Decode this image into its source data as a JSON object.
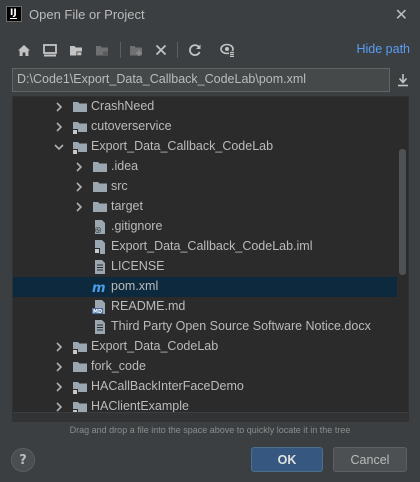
{
  "window": {
    "title": "Open File or Project"
  },
  "toolbar": {
    "buttons": [
      "home-icon",
      "desktop-icon",
      "project-folder-icon",
      "module-folder-icon",
      "new-folder-icon",
      "delete-icon",
      "refresh-icon",
      "show-hidden-icon"
    ],
    "hide_path_label": "Hide path"
  },
  "path": {
    "value": "D:\\Code1\\Export_Data_Callback_CodeLab\\pom.xml"
  },
  "tree": {
    "rows": [
      {
        "label": "CrashNeed",
        "type": "folder",
        "expanded": false,
        "depth": 1,
        "selected": false
      },
      {
        "label": "cutoverservice",
        "type": "module",
        "expanded": false,
        "depth": 1,
        "selected": false
      },
      {
        "label": "Export_Data_Callback_CodeLab",
        "type": "module",
        "expanded": true,
        "depth": 1,
        "selected": false
      },
      {
        "label": ".idea",
        "type": "folder",
        "expanded": false,
        "depth": 2,
        "selected": false
      },
      {
        "label": "src",
        "type": "folder",
        "expanded": false,
        "depth": 2,
        "selected": false
      },
      {
        "label": "target",
        "type": "folder-orange",
        "expanded": false,
        "depth": 2,
        "selected": false
      },
      {
        "label": ".gitignore",
        "type": "file-ignore",
        "depth": 2,
        "selected": false
      },
      {
        "label": "Export_Data_Callback_CodeLab.iml",
        "type": "file-iml",
        "depth": 2,
        "selected": false
      },
      {
        "label": "LICENSE",
        "type": "file-text",
        "depth": 2,
        "selected": false
      },
      {
        "label": "pom.xml",
        "type": "file-maven",
        "depth": 2,
        "selected": true
      },
      {
        "label": "README.md",
        "type": "file-md",
        "depth": 2,
        "selected": false
      },
      {
        "label": "Third Party Open Source Software Notice.docx",
        "type": "file-text",
        "depth": 2,
        "selected": false
      },
      {
        "label": "Export_Data_CodeLab",
        "type": "module",
        "expanded": false,
        "depth": 1,
        "selected": false
      },
      {
        "label": "fork_code",
        "type": "folder",
        "expanded": false,
        "depth": 1,
        "selected": false
      },
      {
        "label": "HACallBackInterFaceDemo",
        "type": "module",
        "expanded": false,
        "depth": 1,
        "selected": false
      },
      {
        "label": "HAClientExample",
        "type": "module",
        "expanded": false,
        "depth": 1,
        "selected": false
      }
    ]
  },
  "hint": "Drag and drop a file into the space above to quickly locate it in the tree",
  "buttons": {
    "help": "?",
    "ok": "OK",
    "cancel": "Cancel"
  },
  "colors": {
    "background": "#3c3f41",
    "tree_background": "#2b2b2b",
    "selection": "#0d293e",
    "link": "#589df6",
    "ok_button": "#365880",
    "maven_icon": "#4a9ee8"
  }
}
